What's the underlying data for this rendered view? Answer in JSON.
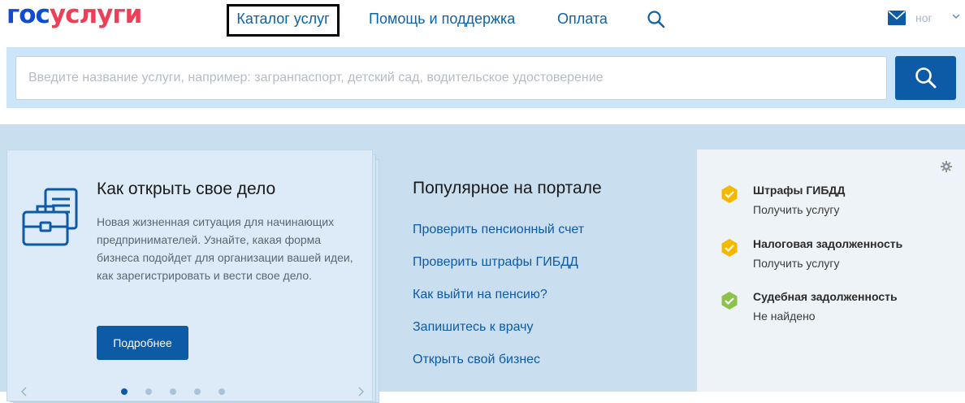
{
  "header": {
    "logo_part1": "гос",
    "logo_part2": "услуги",
    "nav": {
      "catalog": "Каталог услуг",
      "help": "Помощь и поддержка",
      "payment": "Оплата"
    },
    "user_short": "ног"
  },
  "search": {
    "placeholder": "Введите название услуги, например: загранпаспорт, детский сад, водительское удостоверение"
  },
  "card": {
    "title": "Как открыть свое дело",
    "text": "Новая жизненная ситуация для начинающих предпринимателей. Узнайте, какая форма бизнеса подойдет для организации вашей идеи, как зарегистрировать и вести свое дело.",
    "button": "Подробнее"
  },
  "popular": {
    "title": "Популярное на портале",
    "links": [
      "Проверить пенсионный счет",
      "Проверить штрафы ГИБДД",
      "Как выйти на пенсию?",
      "Запишитесь к врачу",
      "Открыть свой бизнес"
    ]
  },
  "status": {
    "items": [
      {
        "title": "Штрафы ГИБДД",
        "sub": "Получить услугу",
        "state": "warning"
      },
      {
        "title": "Налоговая задолженность",
        "sub": "Получить услугу",
        "state": "warning"
      },
      {
        "title": "Судебная задолженность",
        "sub": "Не найдено",
        "state": "ok"
      }
    ]
  },
  "colors": {
    "brand_blue": "#0d4cd3",
    "brand_red": "#ee3f58",
    "link": "#0d5aa7",
    "warning": "#f5b800",
    "ok": "#8bc34a"
  },
  "icons": [
    "search-icon",
    "mail-icon",
    "chevron-down-icon",
    "briefcase-document-icon",
    "gear-icon",
    "check-badge-icon"
  ]
}
